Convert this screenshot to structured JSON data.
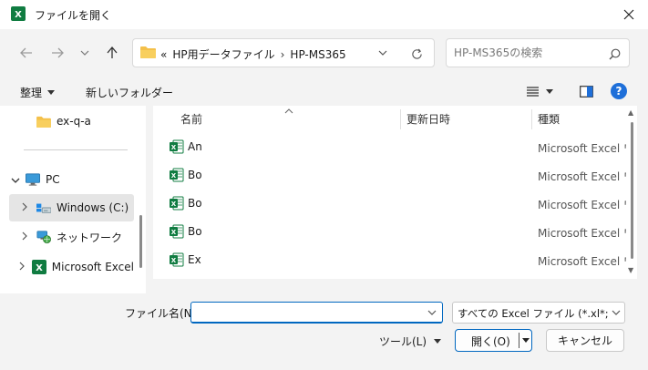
{
  "window": {
    "title": "ファイルを開く",
    "app_icon": "excel-icon"
  },
  "address": {
    "prefix": "«",
    "crumbs": [
      "HP用データファイル",
      "HP-MS365"
    ],
    "separator": "›"
  },
  "search": {
    "placeholder": "HP-MS365の検索"
  },
  "toolbar": {
    "organize_label": "整理",
    "new_folder_label": "新しいフォルダー"
  },
  "nav_pane": {
    "items": [
      {
        "label": "ex-q-a",
        "icon": "folder-icon",
        "expandable": false
      },
      {
        "label": "PC",
        "icon": "pc-icon",
        "expandable": true,
        "expanded": true
      },
      {
        "label": "Windows (C:)",
        "icon": "drive-icon",
        "expandable": true,
        "selected": true
      },
      {
        "label": "ネットワーク",
        "icon": "network-icon",
        "expandable": true
      },
      {
        "label": "Microsoft Excel",
        "icon": "excel-icon",
        "expandable": true
      }
    ]
  },
  "file_list": {
    "columns": {
      "name": "名前",
      "date": "更新日時",
      "type": "種類"
    },
    "rows": [
      {
        "name": "An",
        "type": "Microsoft Excel ワ"
      },
      {
        "name": "Bo",
        "type": "Microsoft Excel ワ"
      },
      {
        "name": "Bo",
        "type": "Microsoft Excel ワ"
      },
      {
        "name": "Bo",
        "type": "Microsoft Excel ワ"
      },
      {
        "name": "Ex",
        "type": "Microsoft Excel ワ"
      }
    ]
  },
  "bottom": {
    "filename_label": "ファイル名(N):",
    "filename_value": "",
    "filetype_value": "すべての Excel ファイル (*.xl*;*.xlsx",
    "tools_label": "ツール(L)",
    "open_label": "開く(O)",
    "cancel_label": "キャンセル"
  },
  "colors": {
    "accent": "#0067c0",
    "excel_green": "#107c41",
    "help_blue": "#1e6fd9",
    "folder_yellow": "#f4c04a"
  }
}
